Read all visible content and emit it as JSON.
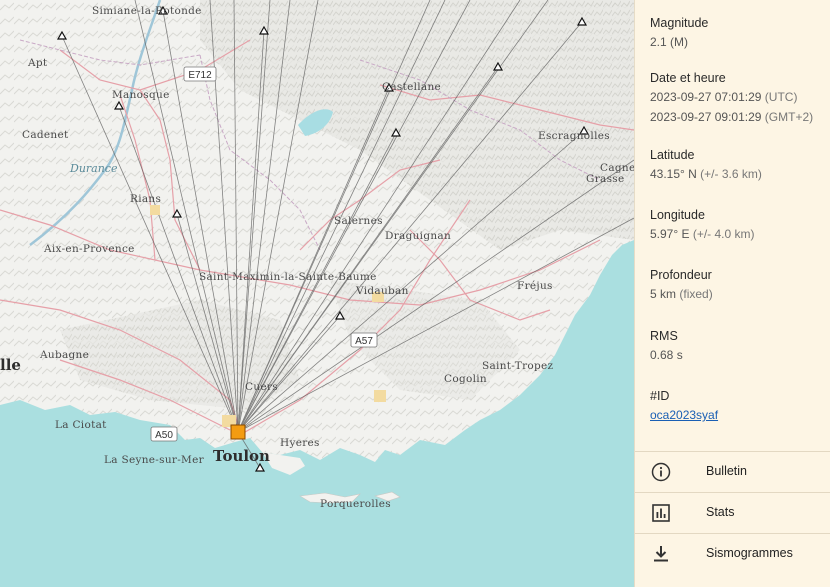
{
  "map": {
    "places": [
      {
        "name": "Simiane-la-Rotonde"
      },
      {
        "name": "Apt"
      },
      {
        "name": "Manosque"
      },
      {
        "name": "Cadenet"
      },
      {
        "name": "Durance"
      },
      {
        "name": "Rians"
      },
      {
        "name": "Aix-en-Provence"
      },
      {
        "name": "Castellane"
      },
      {
        "name": "Escragnolles"
      },
      {
        "name": "Cagnes"
      },
      {
        "name": "Grasse"
      },
      {
        "name": "Salernes"
      },
      {
        "name": "Draguignan"
      },
      {
        "name": "Saint-Maximin-la-Sainte-Baume"
      },
      {
        "name": "Vidauban"
      },
      {
        "name": "Fréjus"
      },
      {
        "name": "Aubagne"
      },
      {
        "name": "lle"
      },
      {
        "name": "Cuers"
      },
      {
        "name": "Saint-Tropez"
      },
      {
        "name": "Cogolin"
      },
      {
        "name": "La Ciotat"
      },
      {
        "name": "La Seyne-sur-Mer"
      },
      {
        "name": "Toulon"
      },
      {
        "name": "Hyeres"
      },
      {
        "name": "Porquerolles"
      }
    ],
    "roads": [
      "E712",
      "A57",
      "A50"
    ],
    "epicenter_color": "#f39c12",
    "station_marker": "triangle-icon"
  },
  "event": {
    "magnitude_label": "Magnitude",
    "magnitude_value": "2.1",
    "magnitude_unit": "(M)",
    "datetime_label": "Date et heure",
    "datetime_utc": "2023-09-27 07:01:29",
    "datetime_utc_suffix": "(UTC)",
    "datetime_local": "2023-09-27 09:01:29",
    "datetime_local_suffix": "(GMT+2)",
    "latitude_label": "Latitude",
    "latitude_value": "43.15° N",
    "latitude_unc": "(+/- 3.6 km)",
    "longitude_label": "Longitude",
    "longitude_value": "5.97° E",
    "longitude_unc": "(+/- 4.0 km)",
    "depth_label": "Profondeur",
    "depth_value": "5 km",
    "depth_note": "(fixed)",
    "rms_label": "RMS",
    "rms_value": "0.68 s",
    "id_label": "#ID",
    "id_value": "oca2023syaf"
  },
  "actions": [
    {
      "label": "Bulletin",
      "icon": "info-icon"
    },
    {
      "label": "Stats",
      "icon": "bar-chart-icon"
    },
    {
      "label": "Sismogrammes",
      "icon": "download-icon"
    }
  ]
}
